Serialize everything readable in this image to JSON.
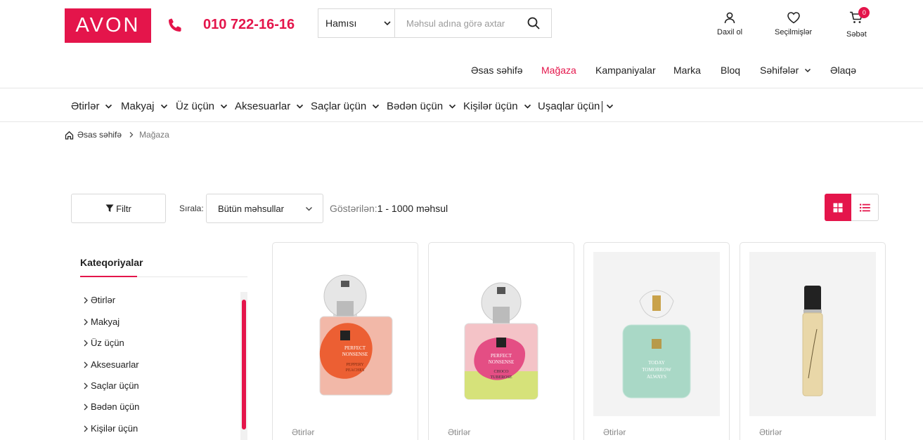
{
  "header": {
    "logo_text": "AVON",
    "phone": "010 722-16-16",
    "search": {
      "category_selected": "Hamısı",
      "placeholder": "Məhsul adına görə axtar"
    },
    "actions": {
      "login_label": "Daxil ol",
      "wishlist_label": "Seçilmişlər",
      "cart_label": "Səbət",
      "cart_count": "0"
    }
  },
  "main_nav": [
    "Əsas səhifə",
    "Mağaza",
    "Kampaniyalar",
    "Marka",
    "Bloq",
    "Səhifələr",
    "Əlaqə"
  ],
  "category_nav": [
    "Ətirlər",
    "Makyaj",
    "Üz üçün",
    "Aksesuarlar",
    "Saçlar üçün",
    "Bədən üçün",
    "Kişilər üçün",
    "Uşaqlar üçün"
  ],
  "breadcrumb": {
    "home": "Əsas səhifə",
    "current": "Mağaza"
  },
  "toolbar": {
    "filter_label": "Filtr",
    "sort_label": "Sırala:",
    "sort_value": "Bütün məhsullar",
    "showing_label": "Göstərilən:",
    "showing_range": "1 - 1000 məhsul"
  },
  "sidebar": {
    "title": "Kateqoriyalar",
    "items": [
      "Ətirlər",
      "Makyaj",
      "Üz üçün",
      "Aksesuarlar",
      "Saçlar üçün",
      "Bədən üçün",
      "Kişilər üçün"
    ]
  },
  "products": [
    {
      "category": "Ətirlər",
      "label_line1": "PERFECT",
      "label_line2": "NONSENSE",
      "label_line3": "PEPPERY",
      "label_line4": "PEACHES"
    },
    {
      "category": "Ətirlər",
      "label_line1": "PERFECT",
      "label_line2": "NONSENSE",
      "label_line3": "CHOCO",
      "label_line4": "TUBEROSE"
    },
    {
      "category": "Ətirlər",
      "label_line1": "TODAY",
      "label_line2": "TOMORROW",
      "label_line3": "ALWAYS"
    },
    {
      "category": "Ətirlər"
    }
  ],
  "colors": {
    "accent": "#e4154b"
  }
}
